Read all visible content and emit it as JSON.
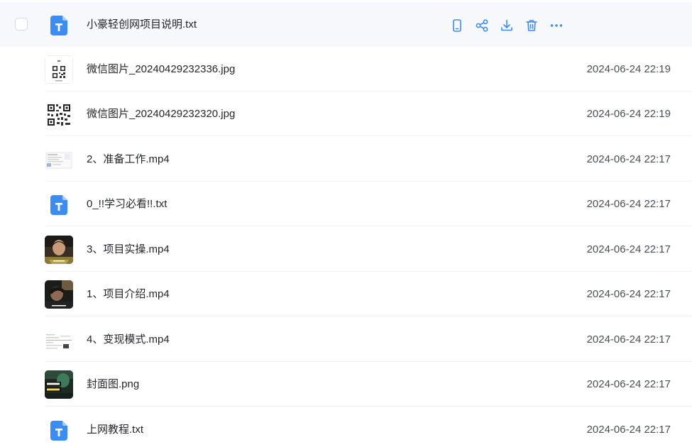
{
  "colors": {
    "accent": "#3a8cf6",
    "hover_row": "#f7f8fb",
    "divider": "#eeeff3"
  },
  "selected_file": {
    "name": "小豪轻创网项目说明.txt",
    "icon": "txt-file-icon",
    "actions": [
      {
        "name": "mobile-icon"
      },
      {
        "name": "share-icon"
      },
      {
        "name": "download-icon"
      },
      {
        "name": "delete-icon"
      },
      {
        "name": "more-icon"
      }
    ]
  },
  "files": [
    {
      "name": "微信图片_20240429232336.jpg",
      "date": "2024-06-24 22:19",
      "thumb": "qr-image-thumbnail"
    },
    {
      "name": "微信图片_20240429232320.jpg",
      "date": "2024-06-24 22:19",
      "thumb": "qr-image-thumbnail"
    },
    {
      "name": "2、准备工作.mp4",
      "date": "2024-06-24 22:17",
      "thumb": "document-video-thumbnail"
    },
    {
      "name": "0_!!学习必看!!.txt",
      "date": "2024-06-24 22:17",
      "thumb": "txt-file-icon"
    },
    {
      "name": "3、项目实操.mp4",
      "date": "2024-06-24 22:17",
      "thumb": "portrait-video-thumbnail"
    },
    {
      "name": "1、项目介绍.mp4",
      "date": "2024-06-24 22:17",
      "thumb": "portrait-video-thumbnail"
    },
    {
      "name": "4、变现模式.mp4",
      "date": "2024-06-24 22:17",
      "thumb": "document-video-thumbnail"
    },
    {
      "name": "封面图.png",
      "date": "2024-06-24 22:17",
      "thumb": "cover-image-thumbnail"
    },
    {
      "name": "上网教程.txt",
      "date": "2024-06-24 22:17",
      "thumb": "txt-file-icon"
    }
  ]
}
